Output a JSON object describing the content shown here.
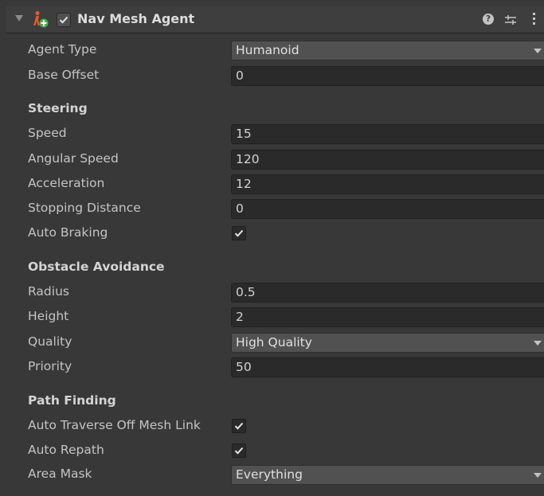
{
  "component": {
    "title": "Nav Mesh Agent",
    "enabled": true,
    "icons": [
      "foldout-arrow-icon",
      "nav-mesh-agent-icon",
      "help-icon",
      "preset-icon",
      "context-menu-icon"
    ]
  },
  "fields": {
    "agent_type": {
      "label": "Agent Type",
      "value": "Humanoid"
    },
    "base_offset": {
      "label": "Base Offset",
      "value": "0"
    }
  },
  "steering": {
    "title": "Steering",
    "speed": {
      "label": "Speed",
      "value": "15"
    },
    "angular_speed": {
      "label": "Angular Speed",
      "value": "120"
    },
    "acceleration": {
      "label": "Acceleration",
      "value": "12"
    },
    "stopping_distance": {
      "label": "Stopping Distance",
      "value": "0"
    },
    "auto_braking": {
      "label": "Auto Braking",
      "checked": true
    }
  },
  "obstacle_avoidance": {
    "title": "Obstacle Avoidance",
    "radius": {
      "label": "Radius",
      "value": "0.5"
    },
    "height": {
      "label": "Height",
      "value": "2"
    },
    "quality": {
      "label": "Quality",
      "value": "High Quality"
    },
    "priority": {
      "label": "Priority",
      "value": "50"
    }
  },
  "path_finding": {
    "title": "Path Finding",
    "auto_traverse": {
      "label": "Auto Traverse Off Mesh Link",
      "checked": true
    },
    "auto_repath": {
      "label": "Auto Repath",
      "checked": true
    },
    "area_mask": {
      "label": "Area Mask",
      "value": "Everything"
    }
  },
  "colors": {
    "background": "#383838",
    "header": "#3e3e3e",
    "field": "#2a2a2a",
    "dropdown": "#515151",
    "text": "#c4c4c4",
    "icon_red": "#e8552f",
    "icon_green": "#47b04b"
  }
}
